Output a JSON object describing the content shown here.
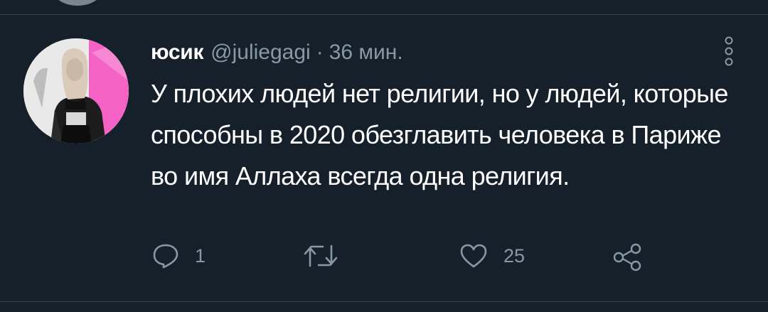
{
  "tweet": {
    "display_name": "юсик",
    "handle": "@juliegagi",
    "separator": "·",
    "time": "36 мин.",
    "text": "У плохих людей нет религии, но у людей, которые способны в 2020 обезглавить человека в Париже во имя Аллаха всегда одна религия."
  },
  "actions": {
    "reply_icon": "comment-bubble-icon",
    "reply_count": "1",
    "retweet_icon": "retweet-icon",
    "retweet_count": "",
    "like_icon": "heart-icon",
    "like_count": "25",
    "share_icon": "share-icon"
  },
  "colors": {
    "background": "#15202b",
    "primary_text": "#ffffff",
    "secondary_text": "#8899a6",
    "divider": "#38444d",
    "avatar_accent": "#f462c5"
  }
}
